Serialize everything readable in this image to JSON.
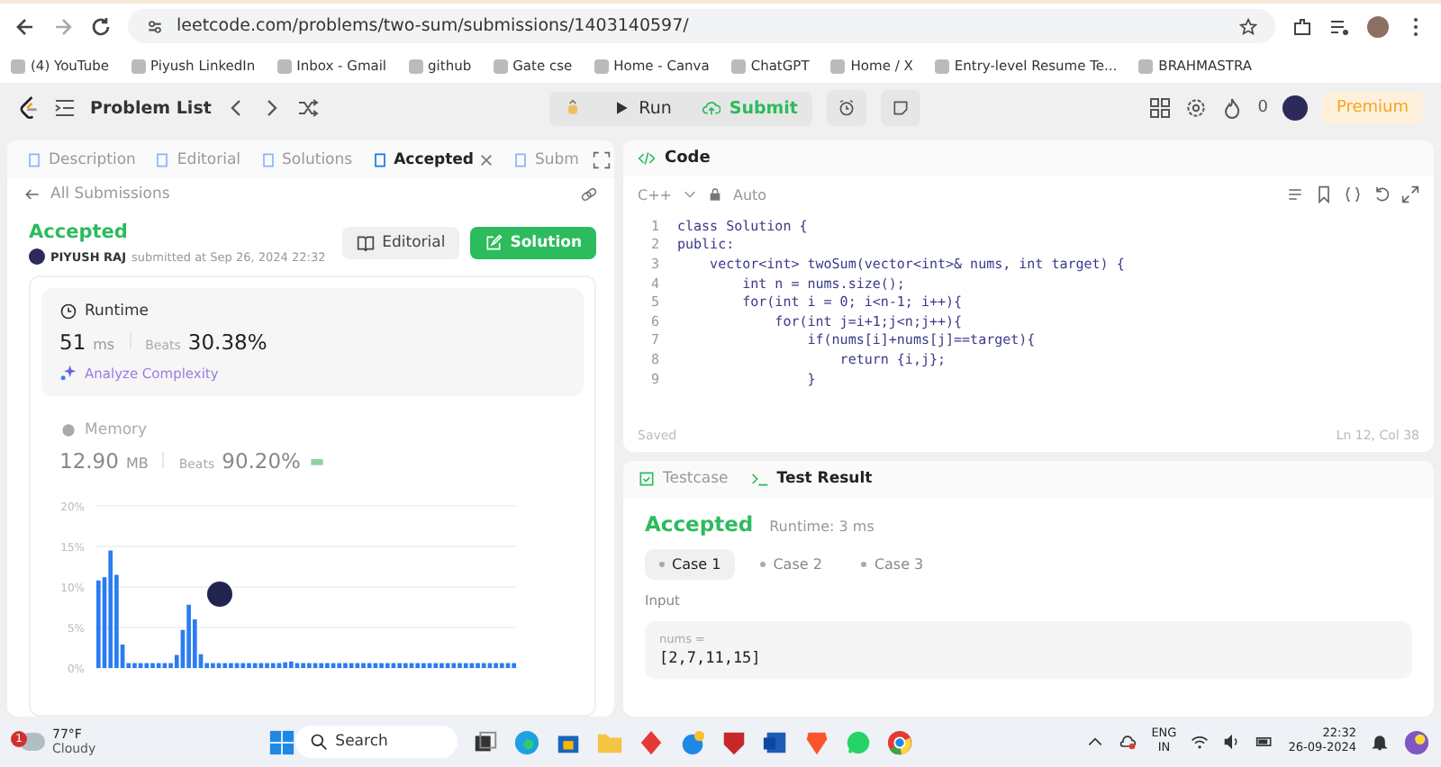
{
  "browser": {
    "url": "leetcode.com/problems/two-sum/submissions/1403140597/",
    "bookmarks": [
      {
        "label": "(4) YouTube"
      },
      {
        "label": "Piyush LinkedIn"
      },
      {
        "label": "Inbox - Gmail"
      },
      {
        "label": "github"
      },
      {
        "label": "Gate cse"
      },
      {
        "label": "Home - Canva"
      },
      {
        "label": "ChatGPT"
      },
      {
        "label": "Home / X"
      },
      {
        "label": "Entry-level Resume Te..."
      },
      {
        "label": "BRAHMASTRA"
      }
    ]
  },
  "nav": {
    "problem_list": "Problem List",
    "run": "Run",
    "submit": "Submit",
    "streak": "0",
    "premium": "Premium"
  },
  "tabs": [
    {
      "label": "Description",
      "selected": false,
      "closable": false
    },
    {
      "label": "Editorial",
      "selected": false,
      "closable": false
    },
    {
      "label": "Solutions",
      "selected": false,
      "closable": false
    },
    {
      "label": "Accepted",
      "selected": true,
      "closable": true
    },
    {
      "label": "Subm",
      "selected": false,
      "closable": false
    }
  ],
  "submission": {
    "back": "All Submissions",
    "status": "Accepted",
    "user": "PIYUSH RAJ",
    "submitted": "submitted at Sep 26, 2024 22:32",
    "editorial": "Editorial",
    "solution": "Solution"
  },
  "runtime": {
    "label": "Runtime",
    "value": "51",
    "unit": "ms",
    "beats_label": "Beats",
    "beats": "30.38%",
    "analyze": "Analyze Complexity"
  },
  "memory": {
    "label": "Memory",
    "value": "12.90",
    "unit": "MB",
    "beats_label": "Beats",
    "beats": "90.20%",
    "chart_data": {
      "type": "bar",
      "grid": true,
      "ylim": [
        0,
        20
      ],
      "yticks": [
        {
          "value": 0,
          "label": "0%"
        },
        {
          "value": 5,
          "label": "5%"
        },
        {
          "value": 10,
          "label": "10%"
        },
        {
          "value": 15,
          "label": "15%"
        },
        {
          "value": 20,
          "label": "20%"
        }
      ],
      "values": [
        10.8,
        11.2,
        14.5,
        11.5,
        2.9,
        0.6,
        0.6,
        0.6,
        0.6,
        0.6,
        0.6,
        0.6,
        0.6,
        1.6,
        4.7,
        7.8,
        6.0,
        1.7,
        0.6,
        0.6,
        0.6,
        0.6,
        0.6,
        0.6,
        0.6,
        0.6,
        0.6,
        0.6,
        0.6,
        0.6,
        0.6,
        0.7,
        0.8,
        0.6,
        0.6,
        0.6,
        0.6,
        0.6,
        0.6,
        0.6,
        0.6,
        0.6,
        0.6,
        0.6,
        0.6,
        0.6,
        0.6,
        0.6,
        0.6,
        0.6,
        0.6,
        0.6,
        0.6,
        0.6,
        0.6,
        0.6,
        0.6,
        0.6,
        0.6,
        0.6,
        0.6,
        0.6,
        0.6,
        0.6,
        0.6,
        0.6,
        0.6,
        0.6,
        0.6,
        0.6
      ]
    }
  },
  "code": {
    "title": "Code",
    "language": "C++",
    "mode": "Auto",
    "lines": [
      {
        "n": "1",
        "text": "class Solution {"
      },
      {
        "n": "2",
        "text": "public:"
      },
      {
        "n": "3",
        "text": "    vector<int> twoSum(vector<int>& nums, int target) {"
      },
      {
        "n": "4",
        "text": "        int n = nums.size();"
      },
      {
        "n": "5",
        "text": "        for(int i = 0; i<n-1; i++){"
      },
      {
        "n": "6",
        "text": "            for(int j=i+1;j<n;j++){"
      },
      {
        "n": "7",
        "text": "                if(nums[i]+nums[j]==target){"
      },
      {
        "n": "8",
        "text": "                    return {i,j};"
      },
      {
        "n": "9",
        "text": "                }"
      }
    ],
    "status": "Saved",
    "cursor": "Ln 12, Col 38"
  },
  "result": {
    "tabs": [
      {
        "label": "Testcase",
        "selected": false
      },
      {
        "label": "Test Result",
        "selected": true
      }
    ],
    "status": "Accepted",
    "runtime": "Runtime: 3 ms",
    "cases": [
      {
        "label": "Case 1",
        "selected": true
      },
      {
        "label": "Case 2",
        "selected": false
      },
      {
        "label": "Case 3",
        "selected": false
      }
    ],
    "input_label": "Input",
    "param": "nums =",
    "value": "[2,7,11,15]"
  },
  "taskbar": {
    "weather_badge": "1",
    "temperature": "77°F",
    "condition": "Cloudy",
    "search_placeholder": "Search",
    "language": "ENG",
    "region": "IN",
    "time": "22:32",
    "date": "26-09-2024"
  }
}
